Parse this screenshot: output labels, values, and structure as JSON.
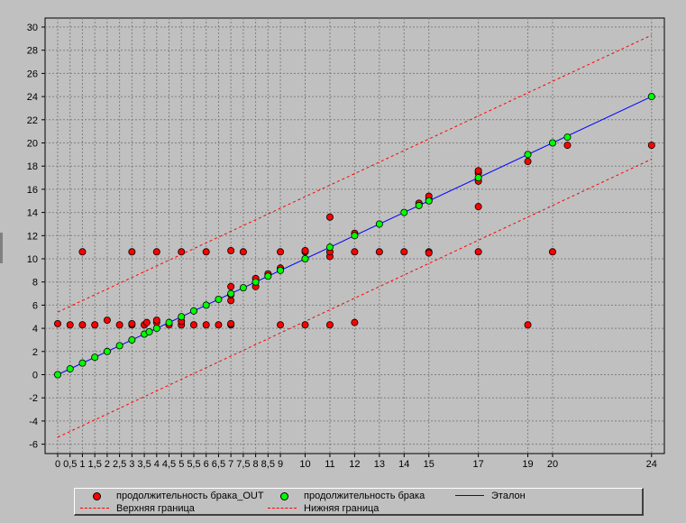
{
  "chart_data": {
    "type": "scatter",
    "xlim": [
      -0.5,
      24.5
    ],
    "ylim": [
      -6,
      30
    ],
    "yticks": [
      -6,
      -4,
      -2,
      0,
      2,
      4,
      6,
      8,
      10,
      12,
      14,
      16,
      18,
      20,
      22,
      24,
      26,
      28,
      30
    ],
    "xticks": [
      "0",
      "0,5",
      "1",
      "1,5",
      "2",
      "2,5",
      "3",
      "3,5",
      "4",
      "4,5",
      "5",
      "5,5",
      "6",
      "6,5",
      "7",
      "7,5",
      "8",
      "8,5",
      "9",
      "10",
      "11",
      "12",
      "13",
      "14",
      "15",
      "17",
      "19",
      "20",
      "24"
    ],
    "xtick_values": [
      0,
      0.5,
      1,
      1.5,
      2,
      2.5,
      3,
      3.5,
      4,
      4.5,
      5,
      5.5,
      6,
      6.5,
      7,
      7.5,
      8,
      8.5,
      9,
      10,
      11,
      12,
      13,
      14,
      15,
      17,
      19,
      20,
      24
    ],
    "grid": true,
    "legend_position": "bottom",
    "colors": {
      "plot_bg": "#c0c0c0",
      "grid": "#808080",
      "out": "#ff0000",
      "fact": "#00ff00",
      "etalon": "#0000ff",
      "bounds": "#ff0000"
    },
    "series": [
      {
        "name": "продолжительность брака_OUT",
        "kind": "points",
        "color": "#ff0000",
        "points": [
          [
            0,
            4.4
          ],
          [
            0.5,
            4.3
          ],
          [
            1,
            4.3
          ],
          [
            1.5,
            4.3
          ],
          [
            1,
            10.6
          ],
          [
            2,
            4.7
          ],
          [
            2.5,
            4.3
          ],
          [
            3,
            4.3
          ],
          [
            3,
            4.4
          ],
          [
            3,
            10.6
          ],
          [
            3.5,
            4.3
          ],
          [
            3.6,
            4.5
          ],
          [
            4,
            4.5
          ],
          [
            4,
            4.7
          ],
          [
            4,
            10.6
          ],
          [
            4.5,
            4.3
          ],
          [
            5,
            4.3
          ],
          [
            5,
            4.6
          ],
          [
            5,
            10.6
          ],
          [
            5.5,
            4.3
          ],
          [
            6,
            4.3
          ],
          [
            6,
            10.6
          ],
          [
            6.5,
            4.3
          ],
          [
            7,
            4.3
          ],
          [
            7,
            4.4
          ],
          [
            7,
            6.4
          ],
          [
            7,
            6.9
          ],
          [
            7,
            7.6
          ],
          [
            7,
            10.7
          ],
          [
            7.5,
            10.6
          ],
          [
            8,
            7.6
          ],
          [
            8,
            8.3
          ],
          [
            8.5,
            8.7
          ],
          [
            9,
            9.2
          ],
          [
            9,
            10.6
          ],
          [
            9,
            4.3
          ],
          [
            10,
            4.3
          ],
          [
            10,
            10.6
          ],
          [
            10,
            10.7
          ],
          [
            11,
            4.3
          ],
          [
            11,
            10.2
          ],
          [
            11,
            10.6
          ],
          [
            11,
            13.6
          ],
          [
            12,
            4.5
          ],
          [
            12,
            10.6
          ],
          [
            12,
            12.2
          ],
          [
            13,
            10.6
          ],
          [
            14,
            10.6
          ],
          [
            14.6,
            14.8
          ],
          [
            15,
            10.6
          ],
          [
            15,
            10.5
          ],
          [
            15,
            15.1
          ],
          [
            15,
            15.4
          ],
          [
            17,
            10.6
          ],
          [
            17,
            14.5
          ],
          [
            17,
            16.7
          ],
          [
            17,
            17.4
          ],
          [
            17,
            17.6
          ],
          [
            19,
            4.3
          ],
          [
            19,
            18.4
          ],
          [
            20,
            10.6
          ],
          [
            20.6,
            19.8
          ],
          [
            24,
            19.8
          ]
        ]
      },
      {
        "name": "продолжительность брака",
        "kind": "points",
        "color": "#00ff00",
        "points": [
          [
            0,
            0
          ],
          [
            0.5,
            0.5
          ],
          [
            1,
            1
          ],
          [
            1.5,
            1.5
          ],
          [
            2,
            2
          ],
          [
            2.5,
            2.5
          ],
          [
            3,
            3
          ],
          [
            3.5,
            3.5
          ],
          [
            3.7,
            3.7
          ],
          [
            4,
            4
          ],
          [
            4.5,
            4.5
          ],
          [
            5,
            5
          ],
          [
            5.5,
            5.5
          ],
          [
            6,
            6
          ],
          [
            6.5,
            6.5
          ],
          [
            7,
            7
          ],
          [
            7.5,
            7.5
          ],
          [
            8,
            8
          ],
          [
            8.5,
            8.5
          ],
          [
            9,
            9
          ],
          [
            10,
            10
          ],
          [
            11,
            11
          ],
          [
            12,
            12
          ],
          [
            13,
            13
          ],
          [
            14,
            14
          ],
          [
            14.6,
            14.6
          ],
          [
            15,
            15
          ],
          [
            17,
            17
          ],
          [
            19,
            19
          ],
          [
            20,
            20
          ],
          [
            20.6,
            20.5
          ],
          [
            24,
            24
          ]
        ]
      },
      {
        "name": "Эталон",
        "kind": "line",
        "style": "solid",
        "color": "#0000ff",
        "points": [
          [
            0,
            0
          ],
          [
            24,
            24
          ]
        ]
      },
      {
        "name": "Верхняя граница",
        "kind": "line",
        "style": "dashed",
        "color": "#ff0000",
        "points": [
          [
            0,
            5.4
          ],
          [
            24,
            29.3
          ]
        ]
      },
      {
        "name": "Нижняя граница",
        "kind": "line",
        "style": "dashed",
        "color": "#ff0000",
        "points": [
          [
            0,
            -5.4
          ],
          [
            24,
            18.6
          ]
        ]
      }
    ]
  }
}
